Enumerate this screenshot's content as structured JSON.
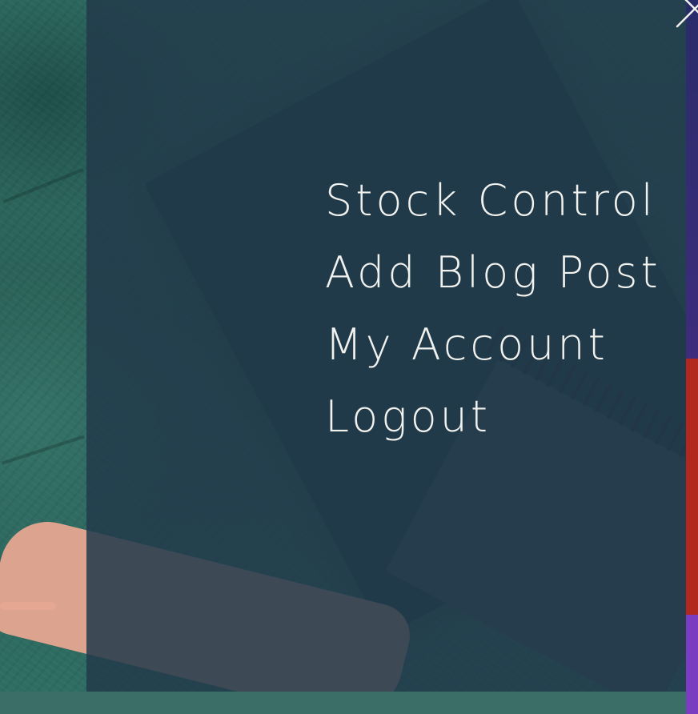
{
  "menu": {
    "close_icon": "close-icon",
    "items": [
      {
        "label": "Stock Control"
      },
      {
        "label": "Add Blog Post"
      },
      {
        "label": "My Account"
      },
      {
        "label": "Logout"
      }
    ]
  },
  "colors": {
    "overlay": "#233a4c",
    "menu_text": "#f1f1ee",
    "background_green": "#2f6b63"
  }
}
